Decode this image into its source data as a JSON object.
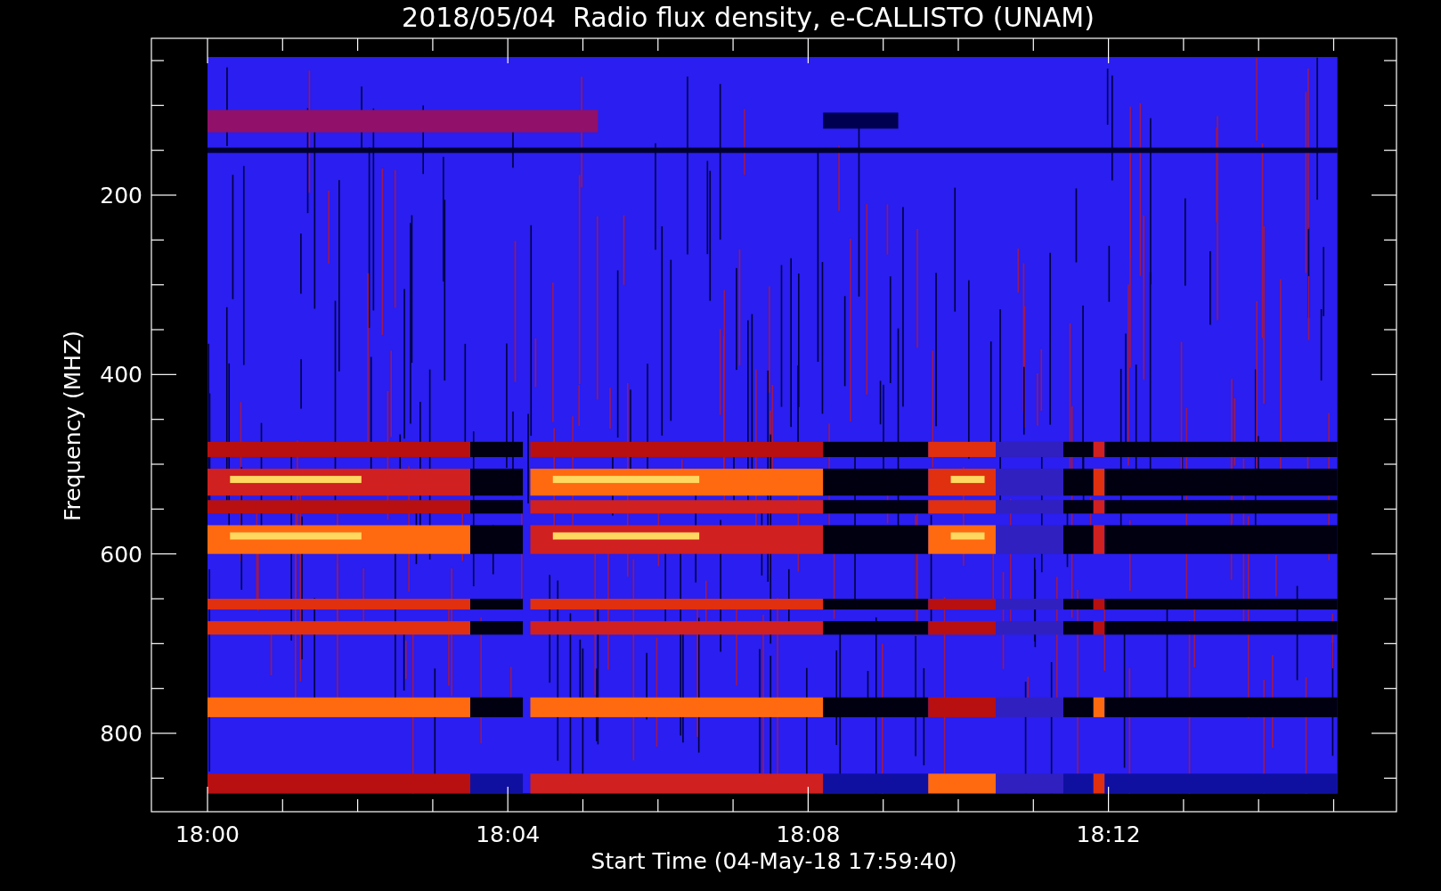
{
  "title": "2018/05/04  Radio flux density, e-CALLISTO (UNAM)",
  "y_axis": {
    "label": "Frequency (MHZ)",
    "ticks": [
      "200",
      "400",
      "600",
      "800"
    ]
  },
  "x_axis": {
    "label": "Start Time (04-May-18 17:59:40)",
    "ticks": [
      "18:00",
      "18:04",
      "18:08",
      "18:12"
    ]
  }
}
